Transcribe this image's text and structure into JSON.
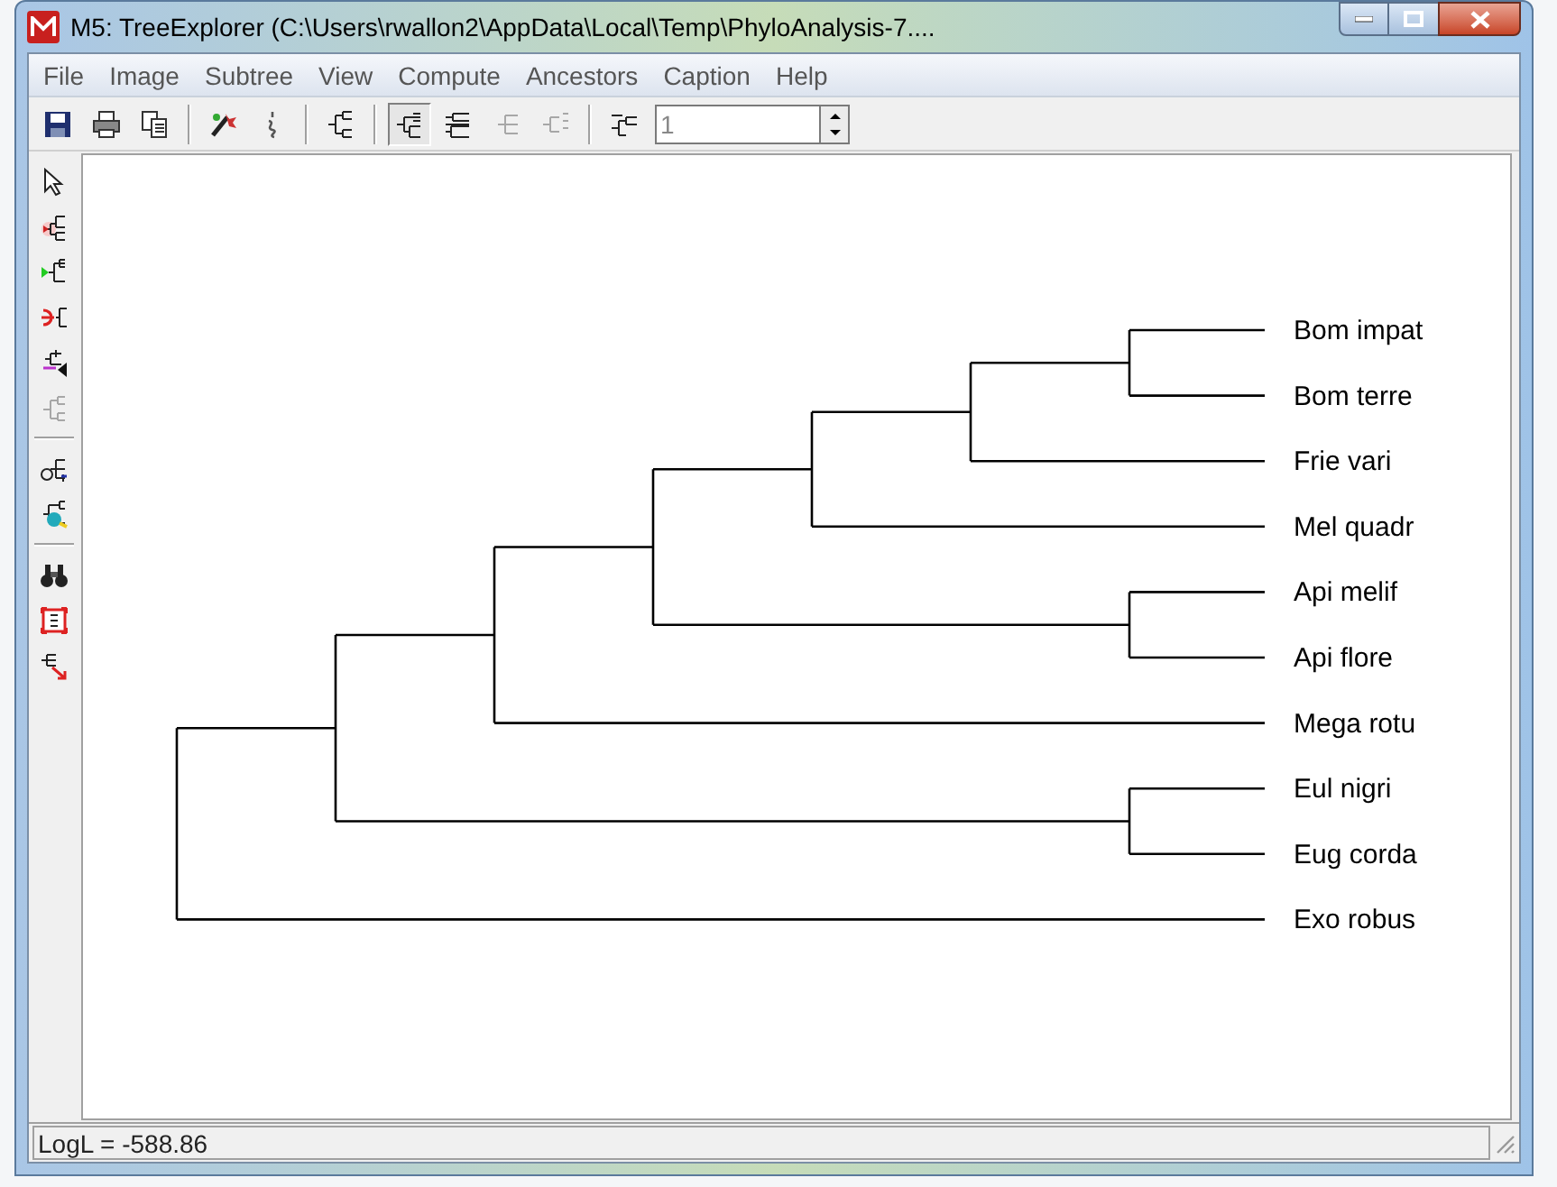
{
  "window": {
    "title": "M5: TreeExplorer (C:\\Users\\rwallon2\\AppData\\Local\\Temp\\PhyloAnalysis-7...."
  },
  "menu": [
    "File",
    "Image",
    "Subtree",
    "View",
    "Compute",
    "Ancestors",
    "Caption",
    "Help"
  ],
  "toolbar": [
    {
      "kind": "button",
      "disabled": false,
      "selected": false
    },
    {
      "kind": "button",
      "disabled": false,
      "selected": false
    },
    {
      "kind": "button",
      "disabled": false,
      "selected": false
    },
    {
      "kind": "separator"
    },
    {
      "kind": "button",
      "disabled": false,
      "selected": false
    },
    {
      "kind": "button",
      "disabled": false,
      "selected": false
    },
    {
      "kind": "separator"
    },
    {
      "kind": "button",
      "disabled": false,
      "selected": false
    },
    {
      "kind": "separator"
    },
    {
      "kind": "button",
      "disabled": false,
      "selected": true
    },
    {
      "kind": "button",
      "disabled": false,
      "selected": false
    },
    {
      "kind": "button",
      "disabled": true,
      "selected": false
    },
    {
      "kind": "button",
      "disabled": true,
      "selected": false
    },
    {
      "kind": "separator"
    },
    {
      "kind": "button",
      "disabled": false,
      "selected": false
    },
    {
      "kind": "spinner",
      "value": "1"
    }
  ],
  "side_toolbar": [
    {
      "kind": "button",
      "disabled": false
    },
    {
      "kind": "button",
      "disabled": false
    },
    {
      "kind": "button",
      "disabled": false
    },
    {
      "kind": "button",
      "disabled": false
    },
    {
      "kind": "button",
      "disabled": false
    },
    {
      "kind": "button",
      "disabled": true
    },
    {
      "kind": "separator"
    },
    {
      "kind": "button",
      "disabled": false
    },
    {
      "kind": "button",
      "disabled": false
    },
    {
      "kind": "separator"
    },
    {
      "kind": "button",
      "disabled": false
    },
    {
      "kind": "button",
      "disabled": false
    },
    {
      "kind": "button",
      "disabled": false
    }
  ],
  "tree": {
    "children": [
      {
        "children": [
          {
            "children": [
              {
                "children": [
                  {
                    "children": [
                      {
                        "children": [
                          {
                            "children": [
                              {
                                "name": "Bom impat"
                              },
                              {
                                "name": "Bom terre"
                              }
                            ]
                          },
                          {
                            "name": "Frie vari"
                          }
                        ]
                      },
                      {
                        "name": "Mel quadr"
                      }
                    ]
                  },
                  {
                    "children": [
                      {
                        "name": "Api melif"
                      },
                      {
                        "name": "Api flore"
                      }
                    ]
                  }
                ]
              },
              {
                "name": "Mega rotu"
              }
            ]
          },
          {
            "children": [
              {
                "name": "Eul nigri"
              },
              {
                "name": "Eug corda"
              }
            ]
          }
        ]
      },
      {
        "name": "Exo robus"
      }
    ]
  },
  "status_bar": "LogL = -588.86"
}
